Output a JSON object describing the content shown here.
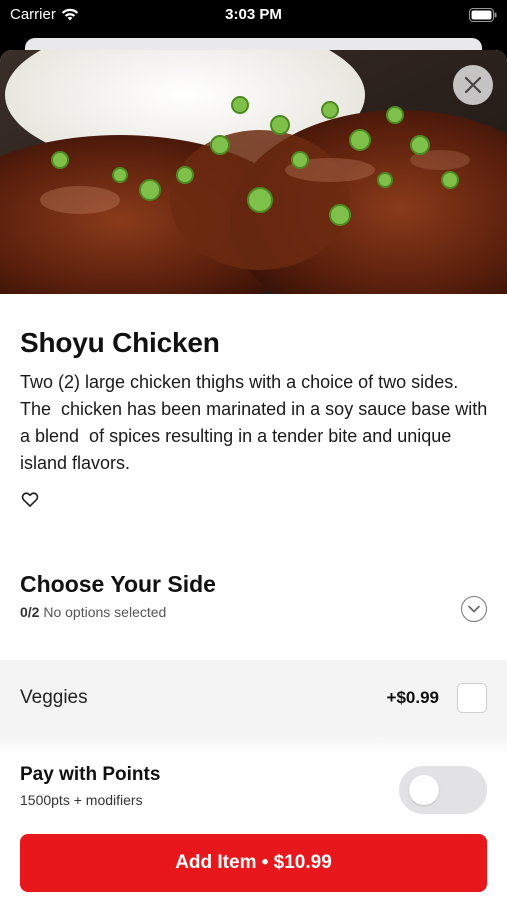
{
  "status_bar": {
    "carrier": "Carrier",
    "time": "3:03 PM"
  },
  "item": {
    "title": "Shoyu Chicken",
    "description": "Two (2) large chicken thighs with a choice of two sides. The  chicken has been marinated in a soy sauce base with a blend  of spices resulting in a tender bite and unique island flavors."
  },
  "side_section": {
    "title": "Choose Your Side",
    "count": "0/2",
    "status": "No options selected"
  },
  "options": [
    {
      "label": "Veggies",
      "price": "+$0.99",
      "checked": false
    }
  ],
  "points": {
    "title": "Pay with Points",
    "subtitle": "1500pts + modifiers",
    "enabled": false
  },
  "cta": {
    "label": "Add Item • $10.99"
  },
  "colors": {
    "accent": "#e8171c",
    "toggle_off": "#e2e2e4",
    "option_bg": "#f4f4f5"
  },
  "icons": {
    "close": "close-icon",
    "favorite": "heart-icon",
    "expand": "chevron-down-icon",
    "wifi": "wifi-icon",
    "battery": "battery-icon"
  }
}
